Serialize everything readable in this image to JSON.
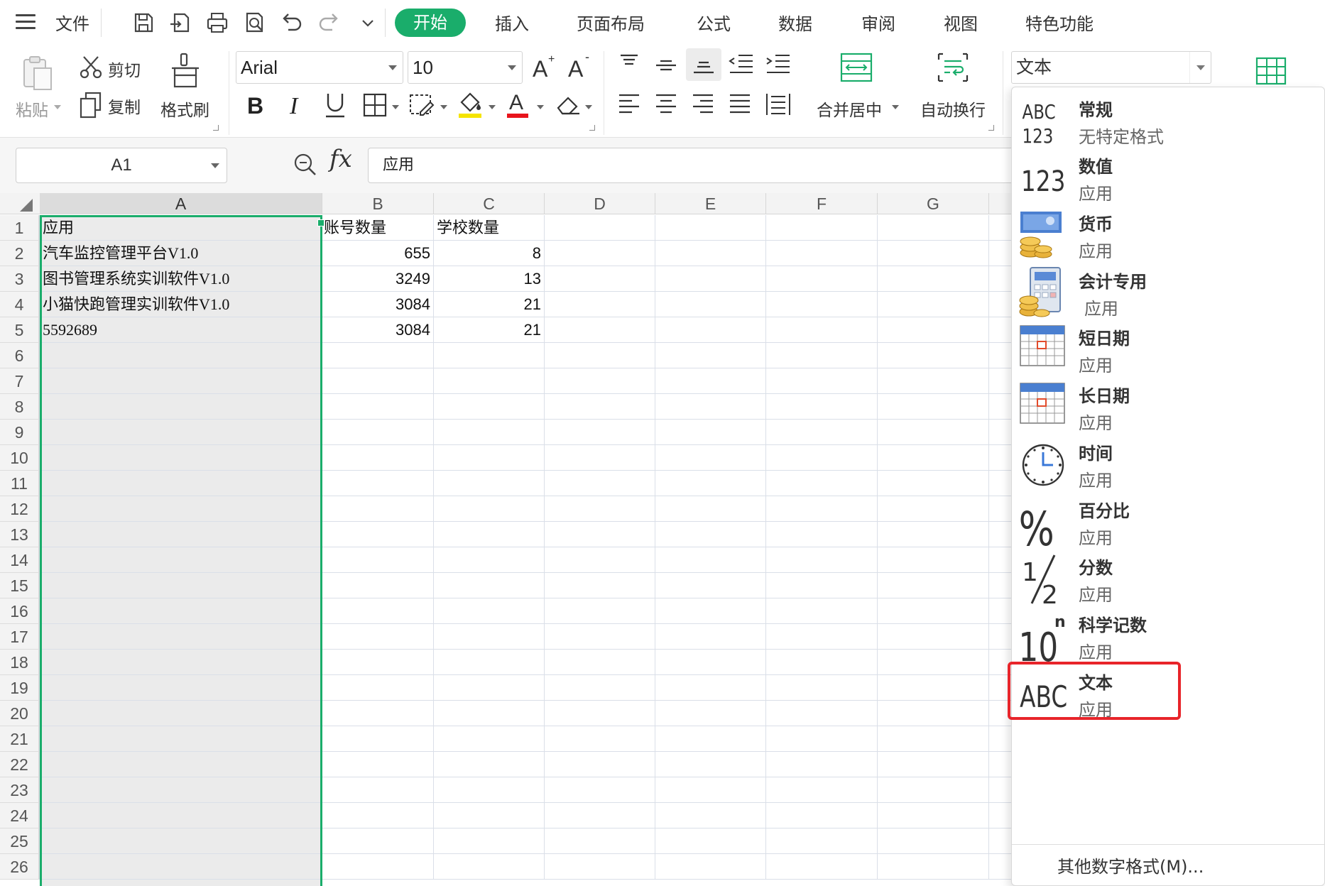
{
  "menubar": {
    "file": "文件",
    "tabs": [
      {
        "label": "开始",
        "active": true
      },
      {
        "label": "插入"
      },
      {
        "label": "页面布局"
      },
      {
        "label": "公式"
      },
      {
        "label": "数据"
      },
      {
        "label": "审阅"
      },
      {
        "label": "视图"
      },
      {
        "label": "特色功能"
      }
    ],
    "accent": "#1aad6b"
  },
  "ribbon": {
    "paste": "粘贴",
    "cut": "剪切",
    "copy": "复制",
    "format_painter": "格式刷",
    "font_name": "Arial",
    "font_size": "10",
    "merge_center": "合并居中",
    "wrap_text": "自动换行",
    "number_format": "文本"
  },
  "formula_bar": {
    "name_box": "A1",
    "fx": "fx",
    "content": "应用"
  },
  "sheet": {
    "columns": [
      "A",
      "B",
      "C",
      "D",
      "E",
      "F",
      "G"
    ],
    "rows": [
      "1",
      "2",
      "3",
      "4",
      "5",
      "6",
      "7",
      "8",
      "9",
      "10",
      "11",
      "12",
      "13",
      "14",
      "15",
      "16",
      "17",
      "18",
      "19",
      "20",
      "21",
      "22",
      "23",
      "24",
      "25",
      "26"
    ],
    "cells": {
      "A1": "应用",
      "B1": "账号数量",
      "C1": "学校数量",
      "A2": "汽车监控管理平台V1.0",
      "B2": "655",
      "C2": "8",
      "A3": "图书管理系统实训软件V1.0",
      "B3": "3249",
      "C3": "13",
      "A4": "小猫快跑管理实训软件V1.0",
      "B4": "3084",
      "C4": "21",
      "A5": "5592689",
      "B5": "3084",
      "C5": "21"
    },
    "selected_column": "A"
  },
  "number_format_menu": {
    "items": [
      {
        "title": "常规",
        "sub": "无特定格式",
        "icon": "general-abc123-icon"
      },
      {
        "title": "数值",
        "sub": "应用",
        "icon": "number-123-icon"
      },
      {
        "title": "货币",
        "sub": "应用",
        "icon": "currency-coins-icon"
      },
      {
        "title": "会计专用",
        "sub": "应用",
        "icon": "accounting-calculator-icon"
      },
      {
        "title": "短日期",
        "sub": "应用",
        "icon": "short-date-calendar-icon"
      },
      {
        "title": "长日期",
        "sub": "应用",
        "icon": "long-date-calendar-icon"
      },
      {
        "title": "时间",
        "sub": "应用",
        "icon": "clock-icon"
      },
      {
        "title": "百分比",
        "sub": "应用",
        "icon": "percent-icon"
      },
      {
        "title": "分数",
        "sub": "应用",
        "icon": "fraction-icon"
      },
      {
        "title": "科学记数",
        "sub": "应用",
        "icon": "scientific-10n-icon"
      },
      {
        "title": "文本",
        "sub": "应用",
        "icon": "text-abc-icon",
        "highlighted": true
      }
    ],
    "more": "其他数字格式(M)...",
    "highlight_color": "#e8242a"
  }
}
